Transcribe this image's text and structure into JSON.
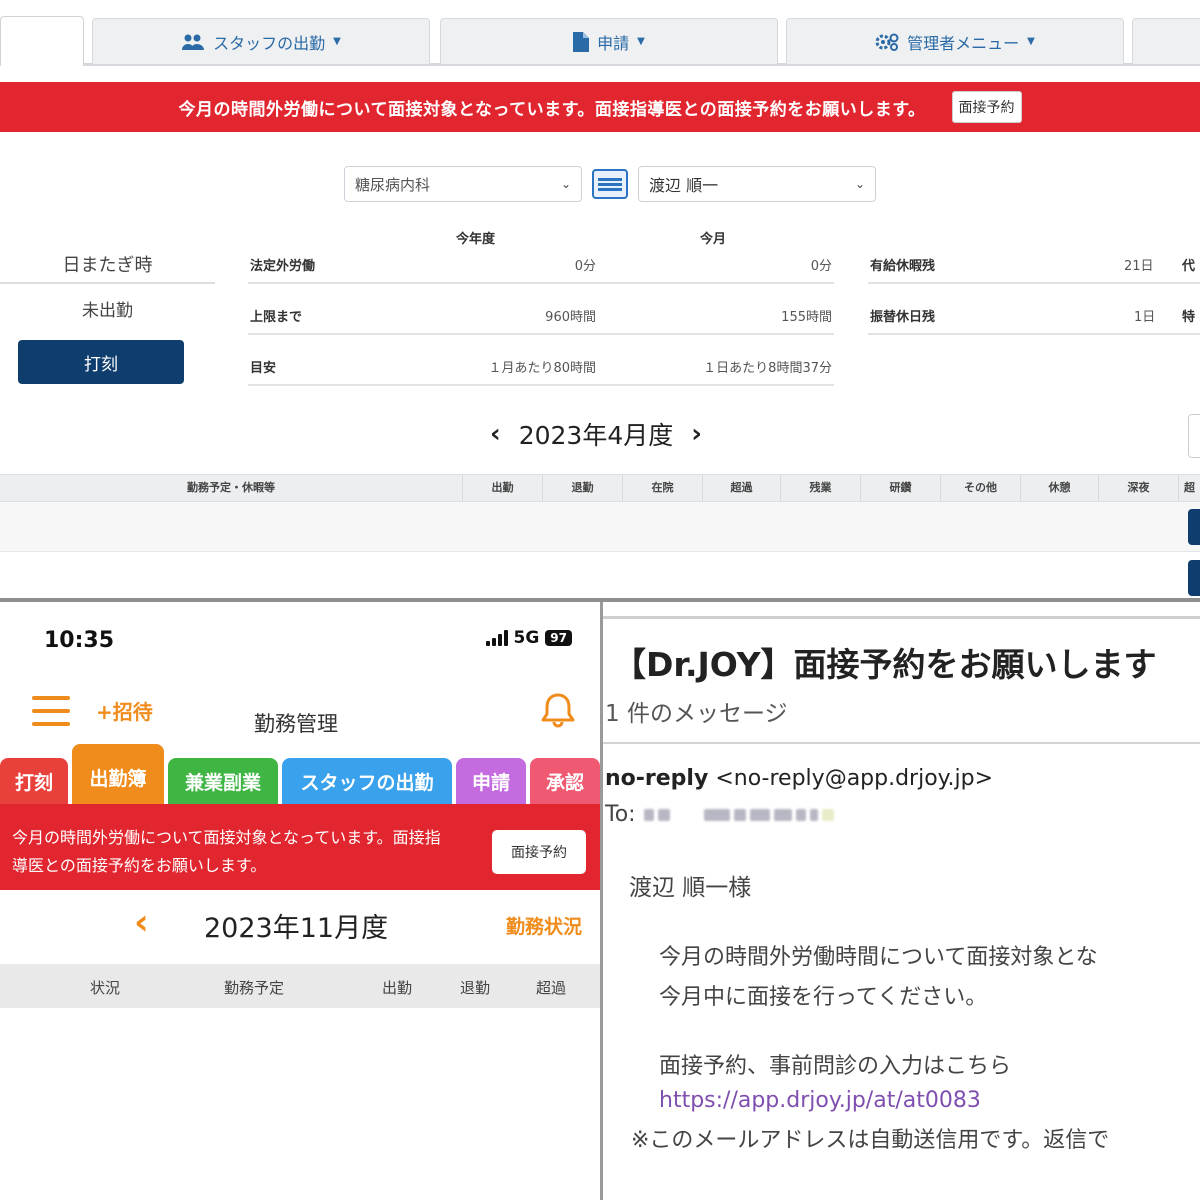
{
  "top": {
    "nav_tabs": [
      {
        "label": "",
        "icon": "blank"
      },
      {
        "label": "スタッフの出勤",
        "icon": "users-icon"
      },
      {
        "label": "申請",
        "icon": "document-icon"
      },
      {
        "label": "管理者メニュー",
        "icon": "gears-icon"
      },
      {
        "label": "",
        "icon": "blank"
      }
    ],
    "alert": {
      "message": "今月の時間外労働について面接対象となっています。面接指導医との面接予約をお願いします。",
      "button": "面接予約",
      "color": "#e2262f"
    },
    "department_select": "糖尿病内科",
    "person_select": "渡辺 順一",
    "left": {
      "overnight": "日またぎ時",
      "not_clocked": "未出勤",
      "stamp_button": "打刻",
      "stamp_color": "#0f3e6e"
    },
    "stats": {
      "col_year": "今年度",
      "col_month": "今月",
      "rows": [
        {
          "label": "法定外労働",
          "year": "0分",
          "month": "0分"
        },
        {
          "label": "上限まで",
          "year": "960時間",
          "month": "155時間"
        },
        {
          "label": "目安",
          "year": "１月あたり80時間",
          "month": "１日あたり8時間37分"
        }
      ]
    },
    "leave": {
      "rows": [
        {
          "label": "有給休暇残",
          "value": "21日",
          "next": "代"
        },
        {
          "label": "振替休日残",
          "value": "1日",
          "next": "特"
        }
      ]
    },
    "month_nav": {
      "prev": "‹",
      "label": "2023年4月度",
      "next": "›"
    },
    "table_headers": [
      "勤務予定・休暇等",
      "出勤",
      "退勤",
      "在院",
      "超過",
      "残業",
      "研鑽",
      "その他",
      "休憩",
      "深夜",
      "超"
    ]
  },
  "mobile": {
    "time": "10:35",
    "network": "5G",
    "battery": "97",
    "invite": "+招待",
    "title": "勤務管理",
    "tabs": [
      {
        "label": "打刻",
        "color": "#e8413c"
      },
      {
        "label": "出勤簿",
        "color": "#f08c1c"
      },
      {
        "label": "兼業副業",
        "color": "#3fb544"
      },
      {
        "label": "スタッフの出勤",
        "color": "#3aa2ec"
      },
      {
        "label": "申請",
        "color": "#c56be0"
      },
      {
        "label": "承認",
        "color": "#ef5a72"
      }
    ],
    "alert": {
      "message": "今月の時間外労働について面接対象となっています。面接指導医との面接予約をお願いします。",
      "button": "面接予約"
    },
    "month": "2023年11月度",
    "work_status": "勤務状況",
    "table_headers": [
      "状況",
      "勤務予定",
      "出勤",
      "退勤",
      "超過"
    ],
    "accent": "#f08c1c"
  },
  "email": {
    "subject": "【Dr.JOY】面接予約をお願いします",
    "message_count": "1 件のメッセージ",
    "from_name": "no-reply",
    "from_addr": "<no-reply@app.drjoy.jp>",
    "to_label": "To:",
    "greeting": "渡辺 順一様",
    "body_line1": "今月の時間外労働時間について面接対象とな",
    "body_line2": "今月中に面接を行ってください。",
    "body_line3": "面接予約、事前問診の入力はこちら",
    "link": "https://app.drjoy.jp/at/at0083",
    "note": "※このメールアドレスは自動送信用です。返信で"
  }
}
